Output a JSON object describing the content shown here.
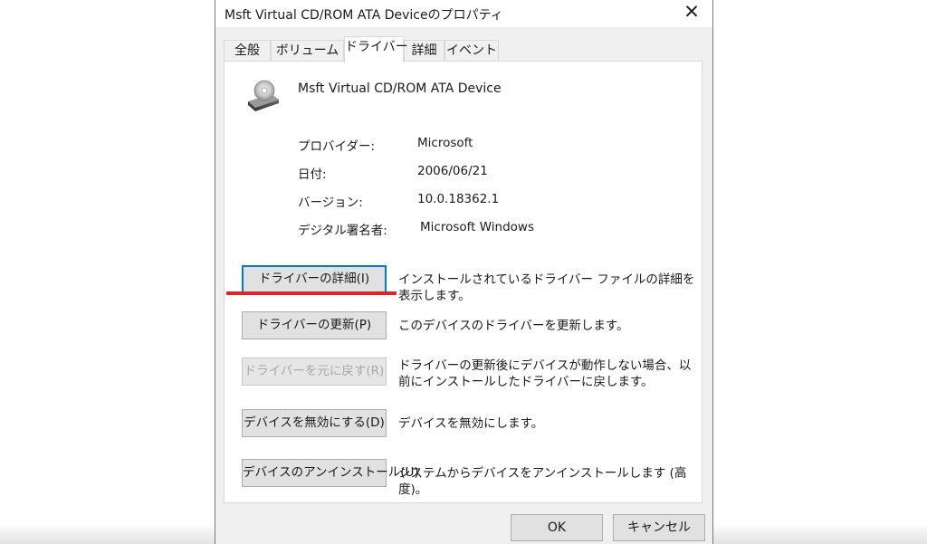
{
  "dialog": {
    "title": "Msft Virtual CD/ROM ATA Deviceのプロパティ",
    "close_glyph": "✕"
  },
  "tabs": [
    {
      "label": "全般",
      "active": false
    },
    {
      "label": "ボリューム",
      "active": false
    },
    {
      "label": "ドライバー",
      "active": true
    },
    {
      "label": "詳細",
      "active": false
    },
    {
      "label": "イベント",
      "active": false
    }
  ],
  "device": {
    "icon": "cd-drive-icon",
    "name": "Msft Virtual CD/ROM ATA Device"
  },
  "info": [
    {
      "label": "プロバイダー:",
      "value": "Microsoft"
    },
    {
      "label": "日付:",
      "value": "2006/06/21"
    },
    {
      "label": "バージョン:",
      "value": "10.0.18362.1"
    },
    {
      "label": "デジタル署名者:",
      "value": "Microsoft Windows"
    }
  ],
  "actions": [
    {
      "label": "ドライバーの詳細(I)",
      "description": "インストールされているドライバー ファイルの詳細を表示します。",
      "enabled": true,
      "focused": true
    },
    {
      "label": "ドライバーの更新(P)",
      "description": "このデバイスのドライバーを更新します。",
      "enabled": true,
      "focused": false
    },
    {
      "label": "ドライバーを元に戻す(R)",
      "description": "ドライバーの更新後にデバイスが動作しない場合、以前にインストールしたドライバーに戻します。",
      "enabled": false,
      "focused": false
    },
    {
      "label": "デバイスを無効にする(D)",
      "description": "デバイスを無効にします。",
      "enabled": true,
      "focused": false
    },
    {
      "label": "デバイスのアンインストール(U)",
      "description": "システムからデバイスをアンインストールします (高度)。",
      "enabled": true,
      "focused": false
    }
  ],
  "footer": {
    "ok_label": "OK",
    "cancel_label": "キャンセル"
  },
  "colors": {
    "highlight_underline": "#d9262c",
    "focus_border": "#0078d7"
  }
}
